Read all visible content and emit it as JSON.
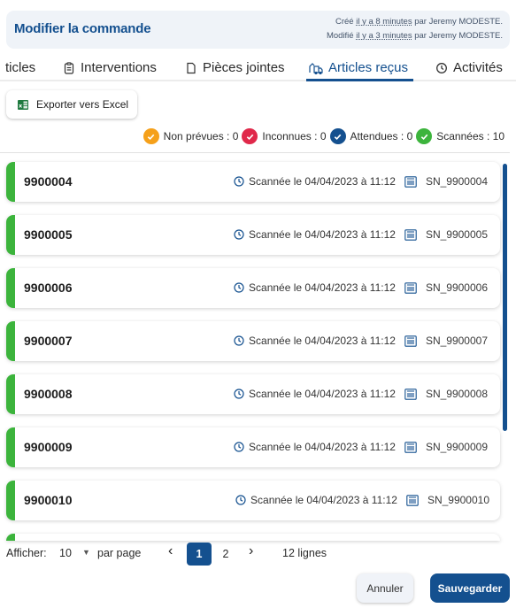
{
  "header": {
    "title": "Modifier la commande",
    "created_prefix": "Créé",
    "created_rel": "il y a 8 minutes",
    "created_suffix": "par Jeremy MODESTE.",
    "modified_prefix": "Modifié",
    "modified_rel": "il y a 3 minutes",
    "modified_suffix": "par Jeremy MODESTE."
  },
  "tabs": [
    {
      "label": "ticles",
      "icon": "none"
    },
    {
      "label": "Interventions",
      "icon": "clipboard-icon"
    },
    {
      "label": "Pièces jointes",
      "icon": "file-icon"
    },
    {
      "label": "Articles reçus",
      "icon": "truck-icon",
      "active": true
    },
    {
      "label": "Activités",
      "icon": "history-icon"
    }
  ],
  "toolbar": {
    "export_label": "Exporter vers Excel",
    "export_icon": "excel-icon"
  },
  "stats": [
    {
      "label": "Non prévues :",
      "value": "0",
      "color": "#f5a01a"
    },
    {
      "label": "Inconnues :",
      "value": "0",
      "color": "#e0284a"
    },
    {
      "label": "Attendues :",
      "value": "0",
      "color": "#14508f"
    },
    {
      "label": "Scannées :",
      "value": "10",
      "color": "#3cb43c"
    }
  ],
  "colors": {
    "primary": "#14508f",
    "scanned": "#3cb43c"
  },
  "rows": [
    {
      "number": "9900004",
      "status": "Scannée le 04/04/2023 à 11:12",
      "serial": "SN_9900004"
    },
    {
      "number": "9900005",
      "status": "Scannée le 04/04/2023 à 11:12",
      "serial": "SN_9900005"
    },
    {
      "number": "9900006",
      "status": "Scannée le 04/04/2023 à 11:12",
      "serial": "SN_9900006"
    },
    {
      "number": "9900007",
      "status": "Scannée le 04/04/2023 à 11:12",
      "serial": "SN_9900007"
    },
    {
      "number": "9900008",
      "status": "Scannée le 04/04/2023 à 11:12",
      "serial": "SN_9900008"
    },
    {
      "number": "9900009",
      "status": "Scannée le 04/04/2023 à 11:12",
      "serial": "SN_9900009"
    },
    {
      "number": "9900010",
      "status": "Scannée le 04/04/2023 à 11:12",
      "serial": "SN_9900010"
    },
    {
      "number": "",
      "status": "",
      "serial": ""
    }
  ],
  "pagination": {
    "show_label": "Afficher:",
    "per_page": "10",
    "per_page_suffix": "par page",
    "prev": "‹",
    "pages": [
      "1",
      "2"
    ],
    "current_page": "1",
    "next": "›",
    "total": "12 lignes"
  },
  "actions": {
    "cancel_label": "Annuler",
    "save_label": "Sauvegarder"
  }
}
